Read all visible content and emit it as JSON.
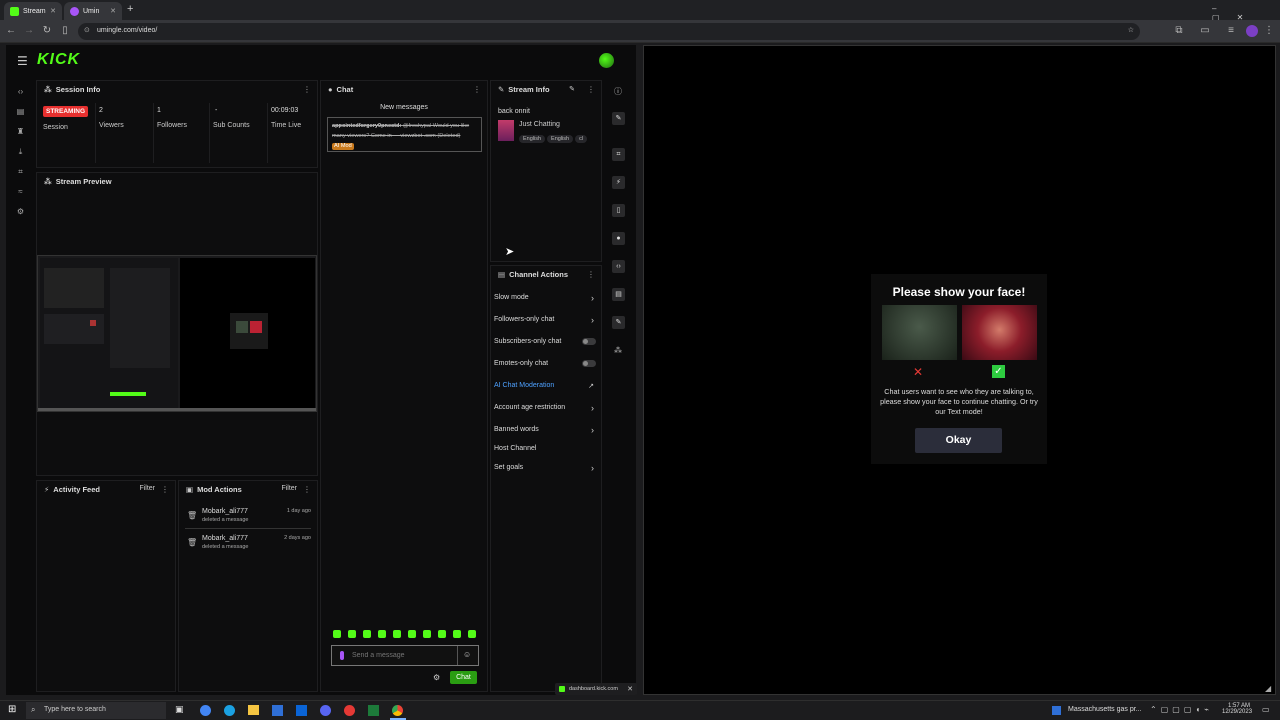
{
  "browser": {
    "tabs": [
      {
        "label": "Stream",
        "active": true,
        "color": "#53fc18"
      },
      {
        "label": "Umin",
        "active": false,
        "color": "#a855f7"
      }
    ],
    "new_tab": "+",
    "url": "umingle.com/video/",
    "window_controls": [
      "–",
      "▢",
      "✕"
    ]
  },
  "kick": {
    "logo": "KICK",
    "rail_icons": [
      "home-icon",
      "layout-icon",
      "trophy-icon",
      "download-icon",
      "crop-icon",
      "chart-icon",
      "settings-icon"
    ],
    "session_info": {
      "title": "Session Info",
      "status_badge": "STREAMING",
      "status_label": "Session",
      "viewers_value": "2",
      "viewers_label": "Viewers",
      "followers_value": "1",
      "followers_label": "Followers",
      "subs_value": "-",
      "subs_label": "Sub Counts",
      "time_value": "00:09:03",
      "time_label": "Time Live"
    },
    "stream_preview": {
      "title": "Stream Preview"
    },
    "activity_feed": {
      "title": "Activity Feed",
      "filter": "Filter"
    },
    "mod_actions": {
      "title": "Mod Actions",
      "filter": "Filter",
      "items": [
        {
          "user": "Mobark_ali777",
          "action": "deleted a message",
          "time": "1 day ago"
        },
        {
          "user": "Mobark_ali777",
          "action": "deleted a message",
          "time": "2 days ago"
        }
      ]
    },
    "chat": {
      "title": "Chat",
      "new_messages": "New messages",
      "message_user": "appointedforgery9pnectd:",
      "message_text": "@freshypal Would you like many viewers? Come in — viewzbot .com",
      "message_deleted": "(Deleted)",
      "message_tag": "AI Mod",
      "input_placeholder": "Send a message",
      "send_button": "Chat"
    },
    "stream_info": {
      "title": "Stream Info",
      "stream_title": "back onnit",
      "category": "Just Chatting",
      "tags": [
        "English",
        "English",
        "cl"
      ]
    },
    "channel_actions": {
      "title": "Channel Actions",
      "items": [
        {
          "label": "Slow mode",
          "kind": "arrow"
        },
        {
          "label": "Followers-only chat",
          "kind": "arrow"
        },
        {
          "label": "Subscribers-only chat",
          "kind": "toggle"
        },
        {
          "label": "Emotes-only chat",
          "kind": "toggle"
        },
        {
          "label": "AI Chat Moderation",
          "kind": "link"
        },
        {
          "label": "Account age restriction",
          "kind": "arrow"
        },
        {
          "label": "Banned words",
          "kind": "arrow"
        },
        {
          "label": "Host Channel",
          "kind": "none"
        },
        {
          "label": "Set goals",
          "kind": "arrow"
        }
      ]
    },
    "popup_url": "dashboard.kick.com"
  },
  "umingle": {
    "modal_title": "Please show your face!",
    "modal_text": "Chat users want to see who they are talking to, please show your face to continue chatting. Or try our Text mode!",
    "ok_button": "Okay",
    "bad_mark": "✕",
    "good_mark": "✓"
  },
  "taskbar": {
    "search_placeholder": "Type here to search",
    "news": "Massachusetts gas pr...",
    "time": "1:57 AM",
    "date": "12/29/2023"
  },
  "colors": {
    "kick_green": "#53fc18",
    "streaming_red": "#e8302f",
    "ai_mod_blue": "#4ea1ff"
  }
}
